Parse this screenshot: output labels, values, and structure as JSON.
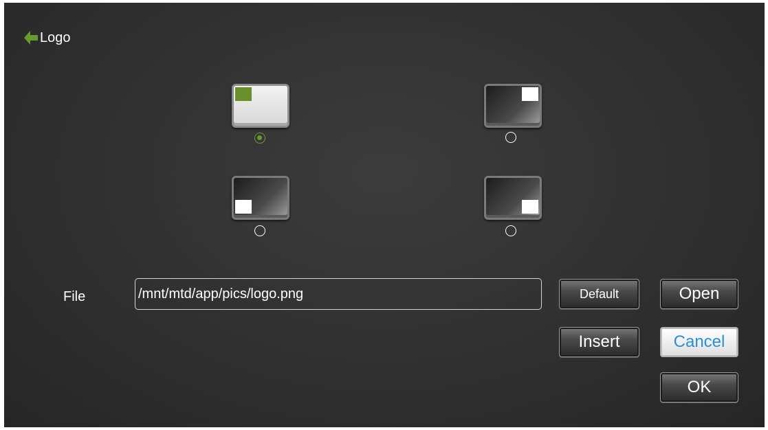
{
  "header": {
    "title": "Logo",
    "back_icon": "back-arrow-icon",
    "accent_color": "#6a9a2e"
  },
  "positions": [
    {
      "id": "top-left",
      "selected": true
    },
    {
      "id": "top-right",
      "selected": false
    },
    {
      "id": "bottom-left",
      "selected": false
    },
    {
      "id": "bottom-right",
      "selected": false
    }
  ],
  "file": {
    "label": "File",
    "path": "/mnt/mtd/app/pics/logo.png"
  },
  "buttons": {
    "default": "Default",
    "open": "Open",
    "insert": "Insert",
    "cancel": "Cancel",
    "ok": "OK"
  }
}
